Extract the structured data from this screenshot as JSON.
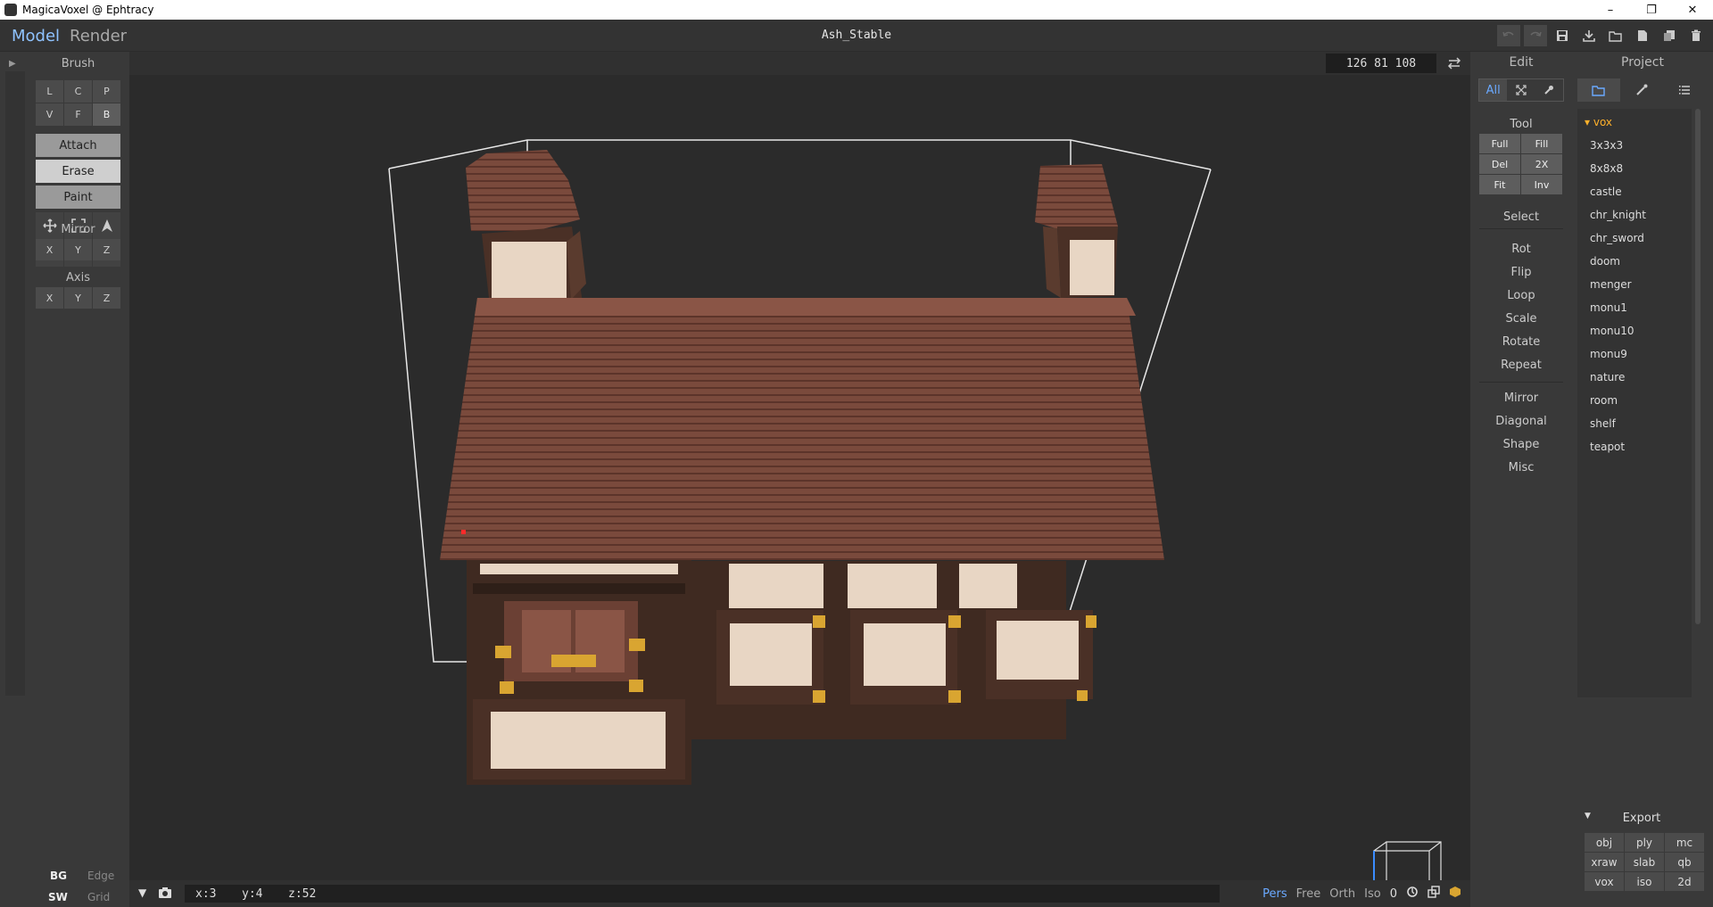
{
  "window": {
    "title": "MagicaVoxel @ Ephtracy"
  },
  "top": {
    "mode_model": "Model",
    "mode_render": "Render",
    "file_name": "Ash_Stable"
  },
  "brush": {
    "title": "Brush",
    "types_row1": [
      "L",
      "C",
      "P"
    ],
    "types_row2": [
      "V",
      "F",
      "B"
    ],
    "attach": "Attach",
    "erase": "Erase",
    "paint": "Paint",
    "mirror_title": "Mirror",
    "mirror": [
      "X",
      "Y",
      "Z"
    ],
    "axis_title": "Axis",
    "axis": [
      "X",
      "Y",
      "Z"
    ],
    "bg": "BG",
    "edge": "Edge",
    "sw": "SW",
    "grid": "Grid"
  },
  "viewport": {
    "dims": "126  81  108",
    "pos_x": "x:3",
    "pos_y": "y:4",
    "pos_z": "z:52",
    "view_pers": "Pers",
    "view_free": "Free",
    "view_orth": "Orth",
    "view_iso": "Iso",
    "view_num": "0"
  },
  "edit": {
    "title": "Edit",
    "filter_all": "All",
    "tool_title": "Tool",
    "tools": [
      "Full",
      "Fill",
      "Del",
      "2X",
      "Fit",
      "Inv"
    ],
    "select": "Select",
    "ops1": [
      "Rot",
      "Flip",
      "Loop",
      "Scale",
      "Rotate",
      "Repeat"
    ],
    "ops2": [
      "Mirror",
      "Diagonal",
      "Shape",
      "Misc"
    ]
  },
  "project": {
    "title": "Project",
    "folder": "vox",
    "files": [
      "3x3x3",
      "8x8x8",
      "castle",
      "chr_knight",
      "chr_sword",
      "doom",
      "menger",
      "monu1",
      "monu10",
      "monu9",
      "nature",
      "room",
      "shelf",
      "teapot"
    ],
    "export_title": "Export",
    "export": [
      "obj",
      "ply",
      "mc",
      "xraw",
      "slab",
      "qb",
      "vox",
      "iso",
      "2d"
    ]
  },
  "colors": {
    "accent": "#6aa9ff",
    "roof": "#7a4a3c",
    "wood": "#4a3026",
    "plaster": "#e8d6c4",
    "gold": "#d9a531"
  }
}
